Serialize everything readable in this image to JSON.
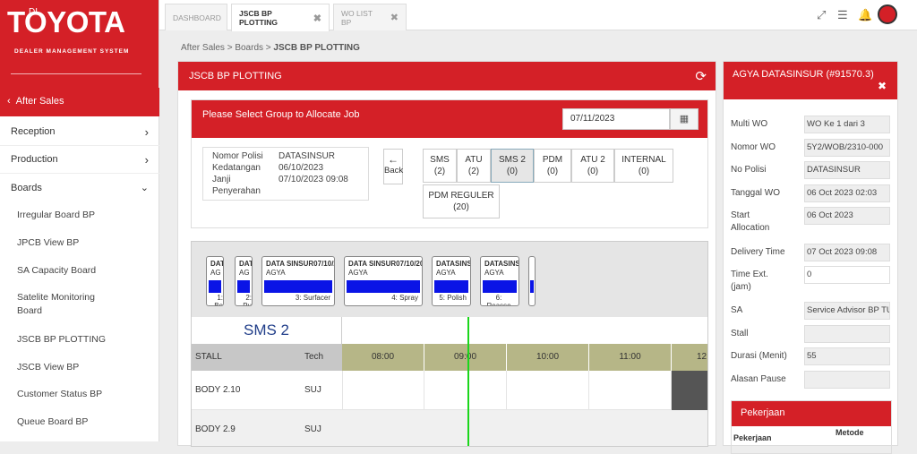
{
  "brand": {
    "di": "DI",
    "logo": "TOYOTA",
    "subtitle": "DEALER MANAGEMENT SYSTEM"
  },
  "sidebar": {
    "back_label": "After Sales",
    "items": [
      {
        "label": "Reception",
        "chevron": "›"
      },
      {
        "label": "Production",
        "chevron": "›"
      },
      {
        "label": "Boards",
        "chevron": "⌄"
      }
    ],
    "subitems": [
      "Irregular Board BP",
      "JPCB View BP",
      "SA Capacity Board",
      "Satelite Monitoring Board",
      "JSCB BP PLOTTING",
      "JSCB View BP",
      "Customer Status BP",
      "Queue Board BP"
    ]
  },
  "tabs": [
    {
      "label": "DASHBOARD"
    },
    {
      "label": "JSCB BP PLOTTING",
      "close": "✖"
    },
    {
      "label": "WO LIST BP",
      "close": "✖"
    }
  ],
  "breadcrumb": {
    "p1": "After Sales",
    "sep": ">",
    "p2": "Boards",
    "current": "JSCB BP PLOTTING"
  },
  "main": {
    "title": "JSCB BP PLOTTING",
    "select_label": "Please Select Group to Allocate Job",
    "date": "07/11/2023",
    "info": [
      {
        "k": "Nomor Polisi",
        "v": "DATASINSUR"
      },
      {
        "k": "Kedatangan",
        "v": "06/10/2023"
      },
      {
        "k": "Janji",
        "v": "07/10/2023 09:08"
      },
      {
        "k": "Penyerahan",
        "v": ""
      }
    ],
    "back_label": "Back",
    "groups": [
      {
        "name": "SMS",
        "count": "(2)"
      },
      {
        "name": "ATU",
        "count": "(2)"
      },
      {
        "name": "SMS 2",
        "count": "(0)"
      },
      {
        "name": "PDM",
        "count": "(0)"
      },
      {
        "name": "ATU 2",
        "count": "(0)"
      },
      {
        "name": "INTERNAL",
        "count": "(0)"
      },
      {
        "name": "PDM REGULER",
        "count": "(20)"
      }
    ],
    "jobs": [
      {
        "t1": "DAT",
        "t2": "AG",
        "t3": "1: Bo dy"
      },
      {
        "t1": "DAT",
        "t2": "AG",
        "t3": "2: Pu tty"
      },
      {
        "t1": "DATA SINSUR07/10/2023",
        "t2": "AGYA",
        "t3": "3: Surfacer"
      },
      {
        "t1": "DATA SINSUR07/10/2023",
        "t2": "AGYA",
        "t3": "4: Spray"
      },
      {
        "t1": "DATASINSUR",
        "t2": "AGYA",
        "t3": "5: Polish"
      },
      {
        "t1": "DATASINSUR",
        "t2": "AGYA",
        "t3": "6: Reasse mbly"
      }
    ],
    "group_title": "SMS 2",
    "stall_header": "STALL",
    "tech_header": "Tech",
    "hours": [
      "08:00",
      "09:00",
      "10:00",
      "11:00",
      "12"
    ],
    "stalls": [
      {
        "stall": "BODY 2.10",
        "tech": "SUJ"
      },
      {
        "stall": "BODY 2.9",
        "tech": "SUJ"
      }
    ]
  },
  "detail": {
    "title": "AGYA DATASINSUR (#91570.3)",
    "close": "✖",
    "fields": [
      {
        "label": "Multi WO",
        "value": "WO Ke 1 dari 3"
      },
      {
        "label": "Nomor WO",
        "value": "5Y2/WOB/2310-000"
      },
      {
        "label": "No Polisi",
        "value": "DATASINSUR"
      },
      {
        "label": "Tanggal WO",
        "value": "06 Oct 2023 02:03"
      },
      {
        "label": "Start Allocation",
        "value": "06 Oct 2023"
      },
      {
        "label": "Delivery Time",
        "value": "07 Oct 2023 09:08"
      },
      {
        "label": "Time Ext. (jam)",
        "value": "0"
      },
      {
        "label": "SA",
        "value": "Service Advisor BP TU"
      },
      {
        "label": "Stall",
        "value": ""
      },
      {
        "label": "Durasi (Menit)",
        "value": "55"
      },
      {
        "label": "Alasan Pause",
        "value": ""
      }
    ],
    "pekerjaan_title": "Pekerjaan",
    "col1": "Pekerjaan",
    "col2": "Metode"
  },
  "colors": {
    "brand_red": "#d42027",
    "progress_blue": "#0a14e6",
    "now_line": "#1bd61b",
    "hour_band": "#b6b687"
  }
}
